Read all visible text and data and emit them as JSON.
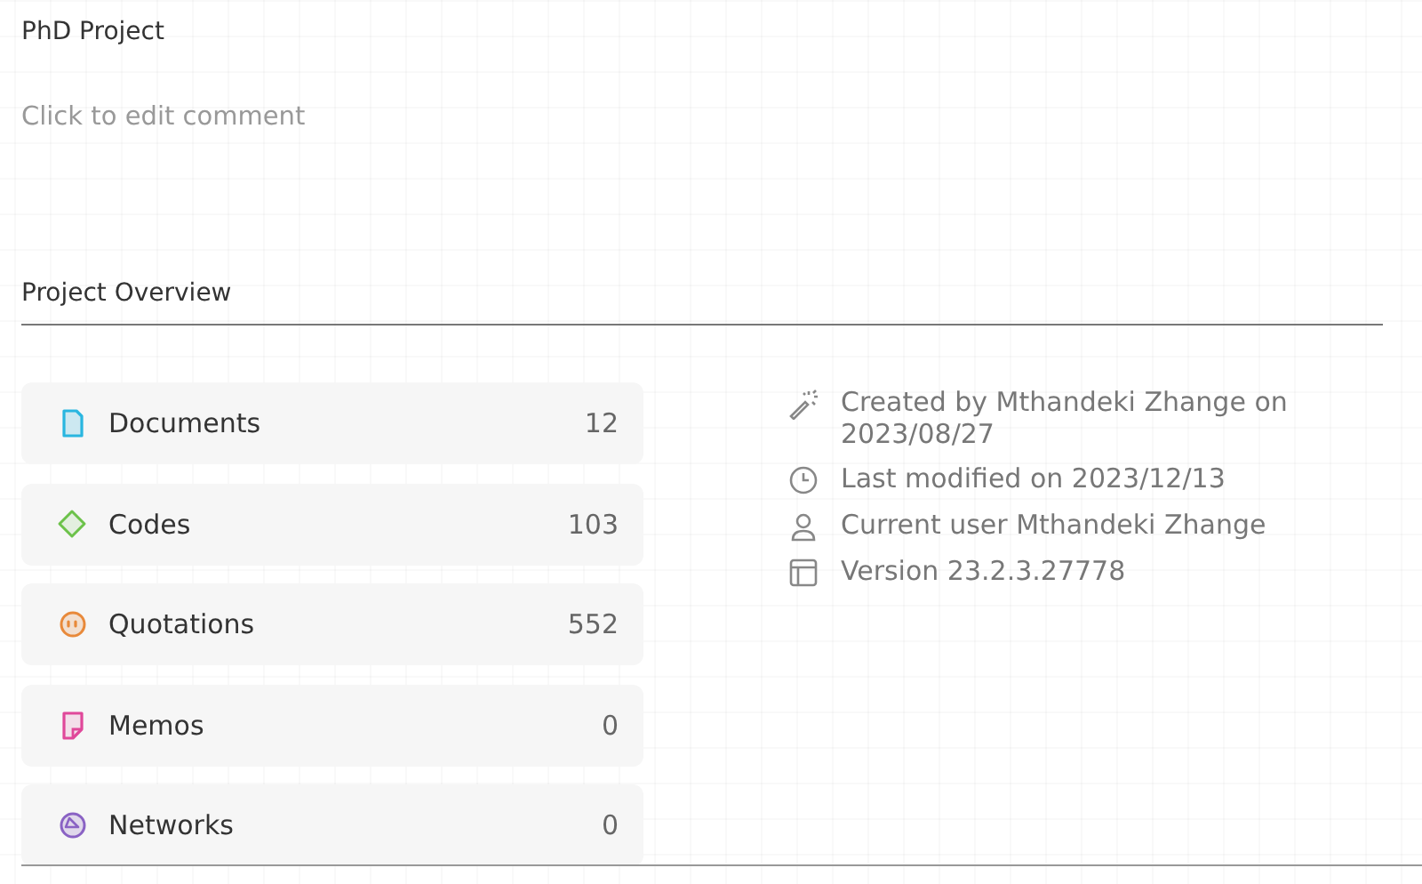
{
  "project": {
    "title": "PhD Project",
    "comment_placeholder": "Click to edit comment"
  },
  "overview": {
    "heading": "Project Overview",
    "entities": [
      {
        "kind": "document",
        "label": "Documents",
        "count": "12",
        "color": "#29b6e0"
      },
      {
        "kind": "code",
        "label": "Codes",
        "count": "103",
        "color": "#6cc24a"
      },
      {
        "kind": "quotation",
        "label": "Quotations",
        "count": "552",
        "color": "#e8893a"
      },
      {
        "kind": "memo",
        "label": "Memos",
        "count": "0",
        "color": "#e0489a"
      },
      {
        "kind": "network",
        "label": "Networks",
        "count": "0",
        "color": "#8a62c4"
      }
    ],
    "info": [
      {
        "kind": "created",
        "text": "Created by Mthandeki Zhange on 2023/08/27"
      },
      {
        "kind": "modified",
        "text": "Last modified on 2023/12/13"
      },
      {
        "kind": "user",
        "text": "Current user Mthandeki Zhange"
      },
      {
        "kind": "version",
        "text": "Version 23.2.3.27778"
      }
    ]
  }
}
